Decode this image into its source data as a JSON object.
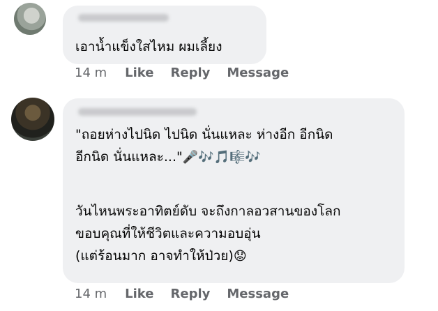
{
  "comments": [
    {
      "text_lines": [
        "เอาน้ำแข็งใสไหม ผมเลี้ยง"
      ],
      "time": "14 m",
      "actions": {
        "like": "Like",
        "reply": "Reply",
        "message": "Message"
      }
    },
    {
      "text_lines": [
        "\"ถอยห่างไปนิด ไปนิด นั่นแหละ ห่างอีก อีกนิด",
        "อีกนิด นั่นแหละ...\"",
        "วันไหนพระอาทิตย์ดับ จะถึงกาลอวสานของโลก",
        "ขอบคุณที่ให้ชีวิตและความอบอุ่น",
        "(แต่ร้อนมาก อาจทำให้ป่วย)"
      ],
      "emoji_music": "🎤🎶🎵🎼🎶",
      "emoji_face": "😟",
      "time": "14 m",
      "actions": {
        "like": "Like",
        "reply": "Reply",
        "message": "Message"
      }
    }
  ]
}
